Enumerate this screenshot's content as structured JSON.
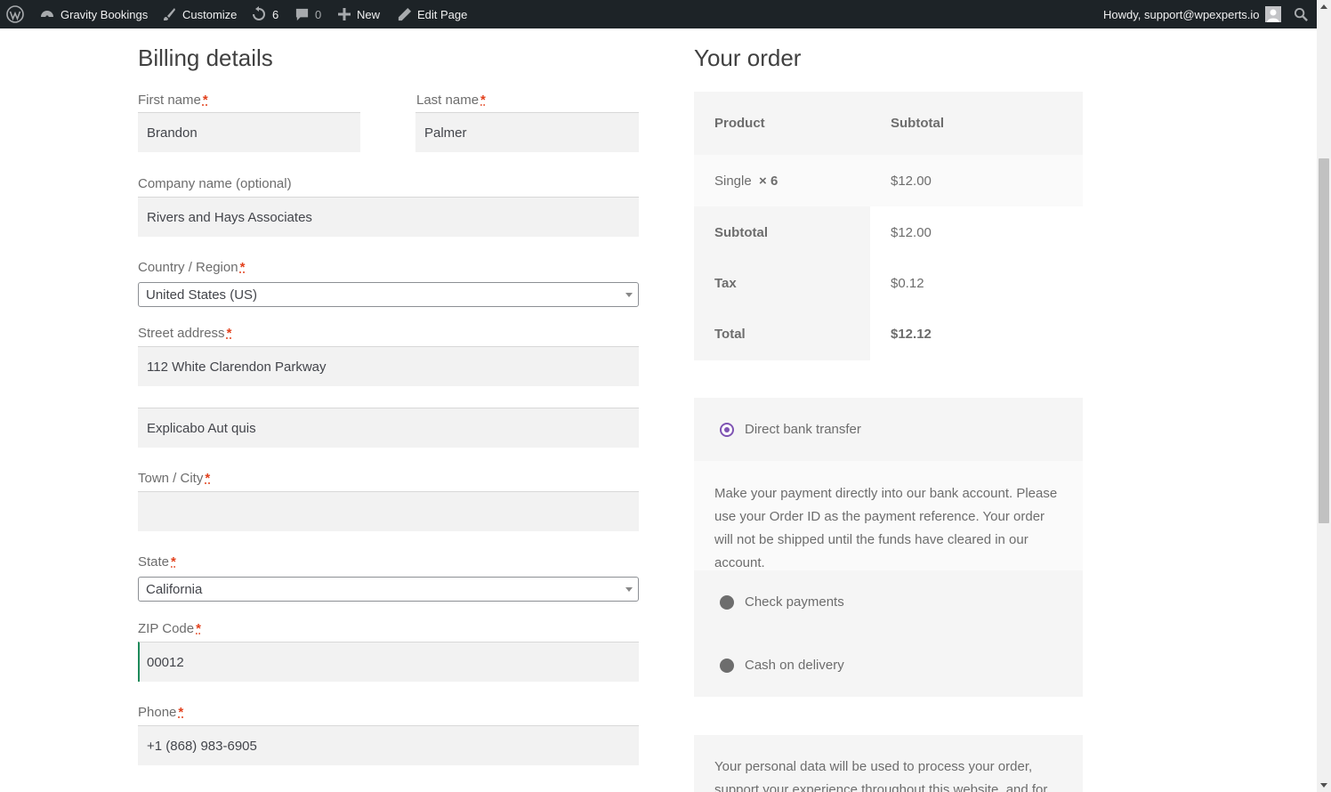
{
  "adminbar": {
    "site_name": "Gravity Bookings",
    "customize": "Customize",
    "updates_count": "6",
    "comments_count": "0",
    "new": "New",
    "edit_page": "Edit Page",
    "howdy": "Howdy, support@wpexperts.io",
    "icons": [
      "wordpress-logo-icon",
      "dashboard-icon",
      "brush-icon",
      "updates-icon",
      "comment-icon",
      "plus-icon",
      "pencil-icon",
      "avatar-icon",
      "search-icon"
    ]
  },
  "billing": {
    "title": "Billing details",
    "required_mark": "*",
    "first_name": {
      "label": "First name",
      "value": "Brandon"
    },
    "last_name": {
      "label": "Last name",
      "value": "Palmer"
    },
    "company": {
      "label": "Company name (optional)",
      "value": "Rivers and Hays Associates"
    },
    "country": {
      "label": "Country / Region",
      "value": "United States (US)"
    },
    "street": {
      "label": "Street address",
      "value": "112 White Clarendon Parkway",
      "value2": "Explicabo Aut quis"
    },
    "city": {
      "label": "Town / City",
      "value": ""
    },
    "state": {
      "label": "State",
      "value": "California"
    },
    "zip": {
      "label": "ZIP Code",
      "value": "00012"
    },
    "phone": {
      "label": "Phone",
      "value": "+1 (868) 983-6905"
    }
  },
  "order": {
    "title": "Your order",
    "col_product": "Product",
    "col_subtotal": "Subtotal",
    "item_name": "Single",
    "item_qty": "× 6",
    "item_total": "$12.00",
    "subtotal_label": "Subtotal",
    "subtotal_value": "$12.00",
    "tax_label": "Tax",
    "tax_value": "$0.12",
    "total_label": "Total",
    "total_value": "$12.12"
  },
  "payment": {
    "methods": [
      {
        "label": "Direct bank transfer",
        "selected": true
      },
      {
        "label": "Check payments",
        "selected": false
      },
      {
        "label": "Cash on delivery",
        "selected": false
      }
    ],
    "bank_description": "Make your payment directly into our bank account. Please use your Order ID as the payment reference. Your order will not be shipped until the funds have cleared in our account.",
    "accent_color": "#7f54b3"
  },
  "privacy": {
    "text": "Your personal data will be used to process your order, support your experience throughout this website, and for"
  }
}
